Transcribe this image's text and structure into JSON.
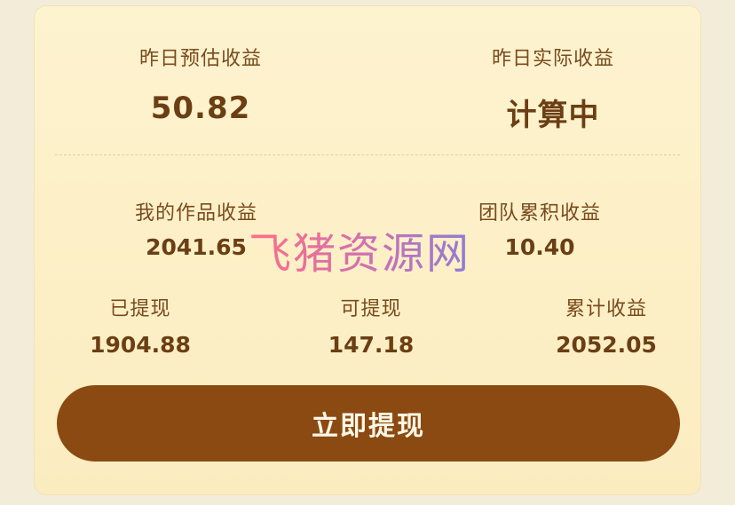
{
  "earnings": {
    "yesterday_estimated": {
      "label": "昨日预估收益",
      "value": "50.82"
    },
    "yesterday_actual": {
      "label": "昨日实际收益",
      "value": "计算中"
    },
    "my_works": {
      "label": "我的作品收益",
      "value": "2041.65"
    },
    "team_accumulated": {
      "label": "团队累积收益",
      "value": "10.40"
    },
    "withdrawn": {
      "label": "已提现",
      "value": "1904.88"
    },
    "available": {
      "label": "可提现",
      "value": "147.18"
    },
    "cumulative": {
      "label": "累计收益",
      "value": "2052.05"
    }
  },
  "withdraw_button": {
    "label": "立即提现"
  },
  "watermark": {
    "text": "飞猪资源网"
  },
  "colors": {
    "card_bg": "#fdf3cf",
    "text_brown": "#6b3e14",
    "button_bg": "#8a4a12",
    "button_text": "#fff7e6"
  }
}
